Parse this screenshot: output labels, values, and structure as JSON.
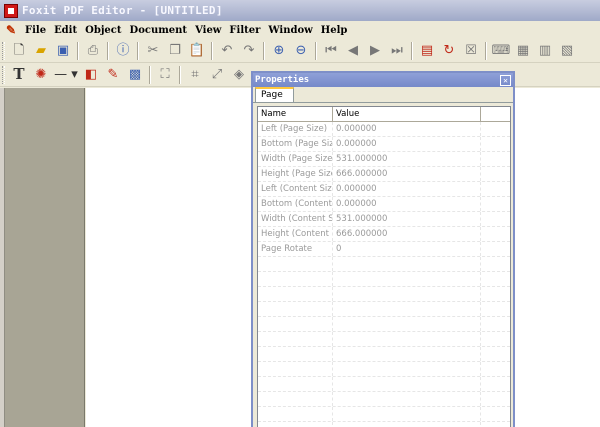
{
  "window": {
    "title": "Foxit PDF Editor - [UNTITLED]"
  },
  "menu": [
    "File",
    "Edit",
    "Object",
    "Document",
    "View",
    "Filter",
    "Window",
    "Help"
  ],
  "toolbar1": [
    "new-doc-icon",
    "open-folder-icon",
    "save-icon",
    "print-icon",
    "info-icon",
    "cut-icon",
    "copy-icon",
    "paste-icon",
    "undo-icon",
    "redo-icon",
    "zoom-in-icon",
    "zoom-out-icon",
    "first-page-icon",
    "prev-page-icon",
    "next-page-icon",
    "last-page-icon",
    "insert-page-icon",
    "rotate-page-icon",
    "delete-page-icon",
    "keyboard-icon",
    "text-object-icon",
    "align-icon",
    "distribute-icon"
  ],
  "toolbar2": [
    "text-tool-icon",
    "color-wheel-icon",
    "line-tool-icon",
    "fill-tool-icon",
    "edit-image-icon",
    "image-tool-icon",
    "select-icon",
    "crop-icon",
    "resize-icon",
    "object-icon"
  ],
  "properties": {
    "title": "Properties",
    "tab": "Page",
    "columns": [
      "Name",
      "Value"
    ],
    "rows": [
      {
        "name": "Left (Page Size)",
        "value": "0.000000"
      },
      {
        "name": "Bottom (Page Size)",
        "value": "0.000000"
      },
      {
        "name": "Width (Page Size)",
        "value": "531.000000"
      },
      {
        "name": "Height (Page Size)",
        "value": "666.000000"
      },
      {
        "name": "Left (Content Size)",
        "value": "0.000000"
      },
      {
        "name": "Bottom (Content Size)",
        "value": "0.000000"
      },
      {
        "name": "Width (Content Size)",
        "value": "531.000000"
      },
      {
        "name": "Height (Content Size)",
        "value": "666.000000"
      },
      {
        "name": "Page Rotate",
        "value": "0"
      }
    ]
  }
}
